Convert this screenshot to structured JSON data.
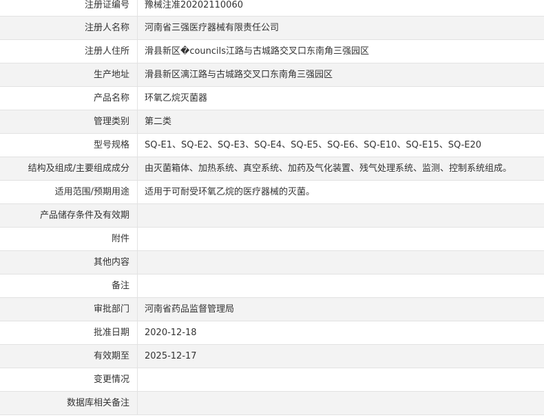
{
  "rows": [
    {
      "label": "注册证编号",
      "value": "豫械注准20202110060"
    },
    {
      "label": "注册人名称",
      "value": "河南省三强医疗器械有限责任公司"
    },
    {
      "label": "注册人住所",
      "value": "滑县新区�councils江路与古城路交叉口东南角三强园区"
    },
    {
      "label": "生产地址",
      "value": "滑县新区漓江路与古城路交叉口东南角三强园区"
    },
    {
      "label": "产品名称",
      "value": "环氧乙烷灭菌器"
    },
    {
      "label": "管理类别",
      "value": "第二类"
    },
    {
      "label": "型号规格",
      "value": "SQ-E1、SQ-E2、SQ-E3、SQ-E4、SQ-E5、SQ-E6、SQ-E10、SQ-E15、SQ-E20"
    },
    {
      "label": "结构及组成/主要组成成分",
      "value": "由灭菌箱体、加热系统、真空系统、加药及气化装置、残气处理系统、监测、控制系统组成。"
    },
    {
      "label": "适用范围/预期用途",
      "value": "适用于可耐受环氧乙烷的医疗器械的灭菌。"
    },
    {
      "label": "产品储存条件及有效期",
      "value": ""
    },
    {
      "label": "附件",
      "value": ""
    },
    {
      "label": "其他内容",
      "value": ""
    },
    {
      "label": "备注",
      "value": ""
    },
    {
      "label": "审批部门",
      "value": "河南省药品监督管理局"
    },
    {
      "label": "批准日期",
      "value": "2020-12-18"
    },
    {
      "label": "有效期至",
      "value": "2025-12-17"
    },
    {
      "label": "变更情况",
      "value": ""
    },
    {
      "label": "数据库相关备注",
      "value": ""
    }
  ]
}
